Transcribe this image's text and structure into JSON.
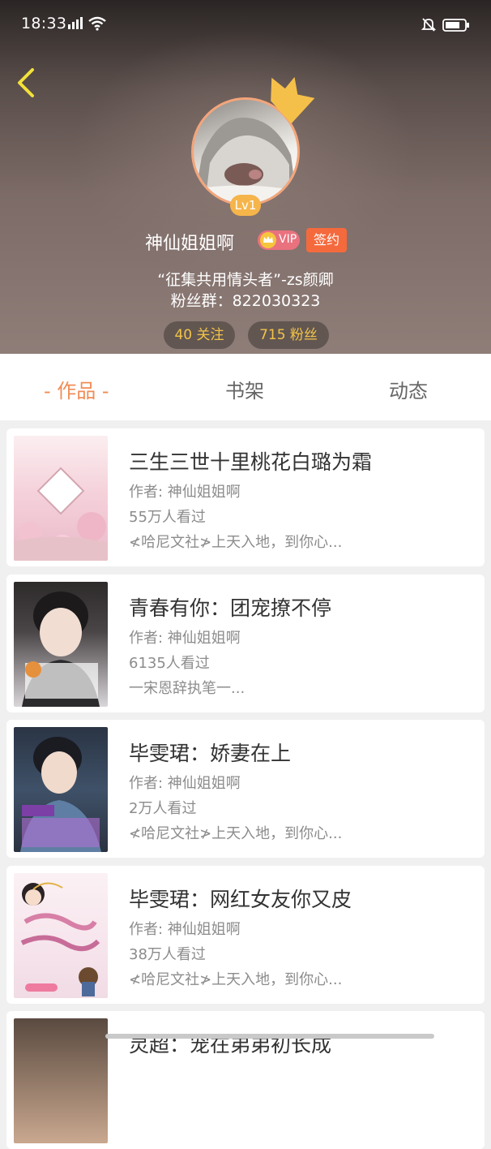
{
  "status_bar": {
    "time": "18:33"
  },
  "profile": {
    "level": "Lv1",
    "username": "神仙姐姐啊",
    "vip_label": "VIP",
    "sign_label": "签约",
    "motto": "“征集共用情头者”-zs颜卿",
    "fan_group": "粉丝群：822030323",
    "following": "40 关注",
    "followers": "715 粉丝"
  },
  "tabs": [
    {
      "label": "- 作品 -",
      "active": true
    },
    {
      "label": "书架",
      "active": false
    },
    {
      "label": "动态",
      "active": false
    }
  ],
  "books": [
    {
      "title": "三生三世十里桃花白璐为霜",
      "author": "作者: 神仙姐姐啊",
      "views": "55万人看过",
      "desc": "≮哈尼文社≯上天入地，到你心..."
    },
    {
      "title": "青春有你：团宠撩不停",
      "author": "作者: 神仙姐姐啊",
      "views": "6135人看过",
      "desc": "一宋恩辞执笔一..."
    },
    {
      "title": "毕雯珺：娇妻在上",
      "author": "作者: 神仙姐姐啊",
      "views": "2万人看过",
      "desc": "≮哈尼文社≯上天入地，到你心..."
    },
    {
      "title": "毕雯珺：网红女友你又皮",
      "author": "作者: 神仙姐姐啊",
      "views": "38万人看过",
      "desc": "≮哈尼文社≯上天入地，到你心..."
    },
    {
      "title": "灵超：宠在弟弟初长成",
      "author": "",
      "views": "",
      "desc": ""
    }
  ],
  "colors": {
    "accent": "#f08c55",
    "stat_text": "#f2c449",
    "sign_bg": "#f56a3d",
    "vip_bg": "#e9727e"
  }
}
